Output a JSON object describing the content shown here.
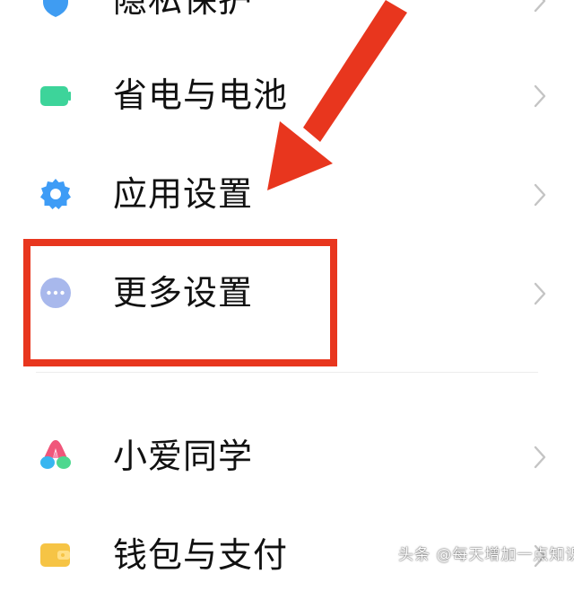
{
  "settings_items": [
    {
      "label": "隐私保护",
      "icon": "privacy-shield-icon",
      "color": "#3f9cf2"
    },
    {
      "label": "省电与电池",
      "icon": "battery-icon",
      "color": "#3dd49a"
    },
    {
      "label": "应用设置",
      "icon": "gear-icon",
      "color": "#3e9cf6"
    },
    {
      "label": "更多设置",
      "icon": "more-dots-icon",
      "color": "#a8b8ec"
    },
    {
      "label": "小爱同学",
      "icon": "xiaoai-icon",
      "color": "#38b6f0"
    },
    {
      "label": "钱包与支付",
      "icon": "wallet-icon",
      "color": "#f6c445"
    }
  ],
  "annotation": {
    "highlight_color": "#e8361e",
    "highlighted_item": "更多设置"
  },
  "watermark": {
    "text": "头条 @每天增加一点知识"
  }
}
